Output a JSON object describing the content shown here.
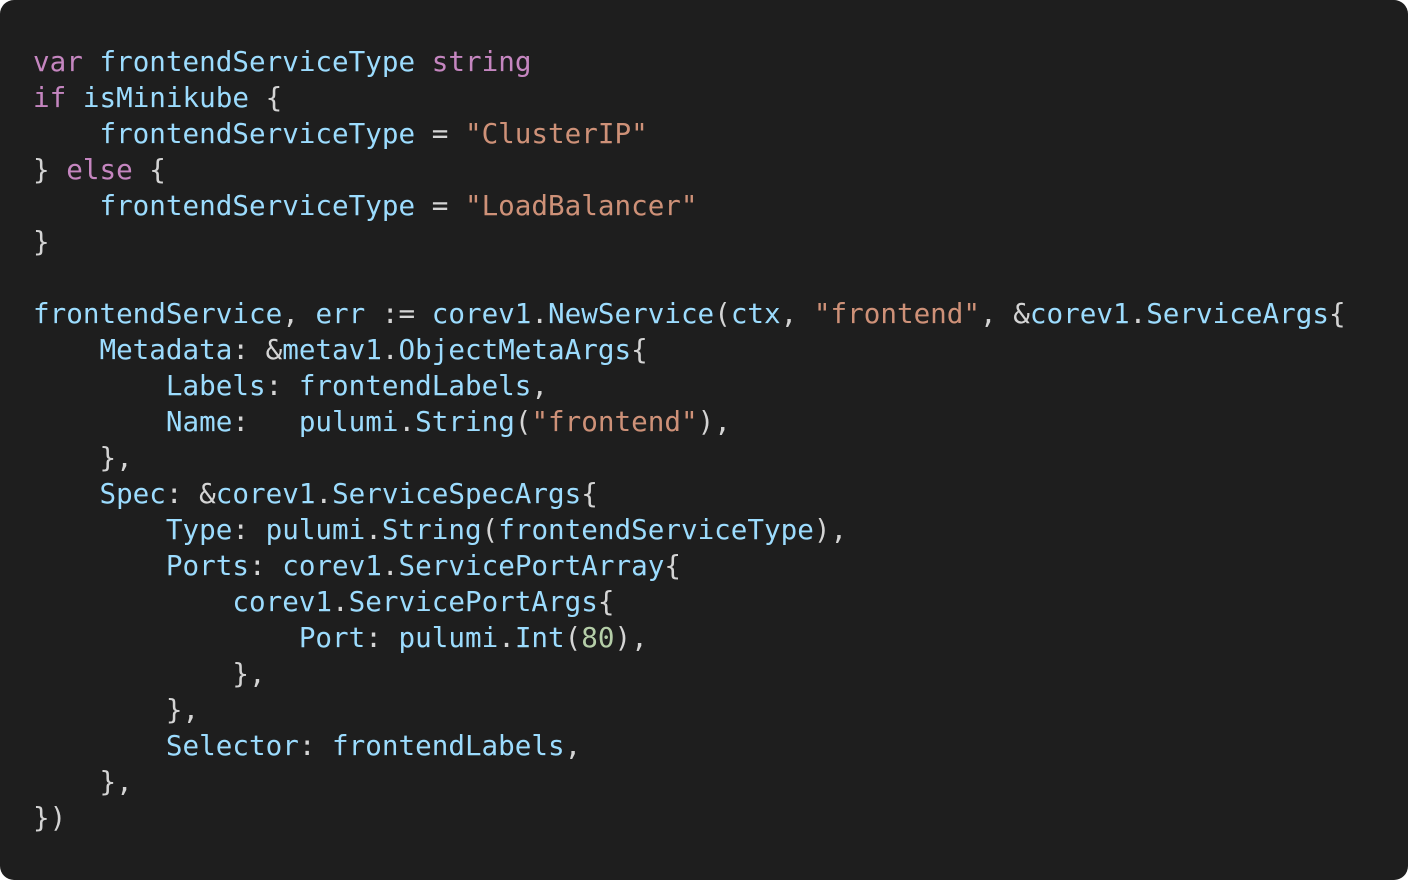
{
  "editor": {
    "background_color": "#1e1e1e",
    "token_colors": {
      "keyword": "#c586c0",
      "type": "#c586c0",
      "ident": "#9cdcfe",
      "func": "#9cdcfe",
      "string": "#ce9178",
      "number": "#b5cea8",
      "punct": "#d4d4d4",
      "plain": "#d4d4d4"
    },
    "lines": [
      [
        [
          "keyword",
          "var"
        ],
        [
          "plain",
          " "
        ],
        [
          "ident",
          "frontendServiceType"
        ],
        [
          "plain",
          " "
        ],
        [
          "type",
          "string"
        ]
      ],
      [
        [
          "keyword",
          "if"
        ],
        [
          "plain",
          " "
        ],
        [
          "ident",
          "isMinikube"
        ],
        [
          "plain",
          " {"
        ]
      ],
      [
        [
          "plain",
          "    "
        ],
        [
          "ident",
          "frontendServiceType"
        ],
        [
          "plain",
          " = "
        ],
        [
          "string",
          "\"ClusterIP\""
        ]
      ],
      [
        [
          "plain",
          "} "
        ],
        [
          "keyword",
          "else"
        ],
        [
          "plain",
          " {"
        ]
      ],
      [
        [
          "plain",
          "    "
        ],
        [
          "ident",
          "frontendServiceType"
        ],
        [
          "plain",
          " = "
        ],
        [
          "string",
          "\"LoadBalancer\""
        ]
      ],
      [
        [
          "plain",
          "}"
        ]
      ],
      [],
      [
        [
          "ident",
          "frontendService"
        ],
        [
          "plain",
          ", "
        ],
        [
          "ident",
          "err"
        ],
        [
          "plain",
          " := "
        ],
        [
          "ident",
          "corev1"
        ],
        [
          "plain",
          "."
        ],
        [
          "func",
          "NewService"
        ],
        [
          "plain",
          "("
        ],
        [
          "ident",
          "ctx"
        ],
        [
          "plain",
          ", "
        ],
        [
          "string",
          "\"frontend\""
        ],
        [
          "plain",
          ", &"
        ],
        [
          "ident",
          "corev1"
        ],
        [
          "plain",
          "."
        ],
        [
          "ident",
          "ServiceArgs"
        ],
        [
          "plain",
          "{"
        ]
      ],
      [
        [
          "plain",
          "    "
        ],
        [
          "ident",
          "Metadata"
        ],
        [
          "plain",
          ": &"
        ],
        [
          "ident",
          "metav1"
        ],
        [
          "plain",
          "."
        ],
        [
          "ident",
          "ObjectMetaArgs"
        ],
        [
          "plain",
          "{"
        ]
      ],
      [
        [
          "plain",
          "        "
        ],
        [
          "ident",
          "Labels"
        ],
        [
          "plain",
          ": "
        ],
        [
          "ident",
          "frontendLabels"
        ],
        [
          "plain",
          ","
        ]
      ],
      [
        [
          "plain",
          "        "
        ],
        [
          "ident",
          "Name"
        ],
        [
          "plain",
          ":   "
        ],
        [
          "ident",
          "pulumi"
        ],
        [
          "plain",
          "."
        ],
        [
          "func",
          "String"
        ],
        [
          "plain",
          "("
        ],
        [
          "string",
          "\"frontend\""
        ],
        [
          "plain",
          "),"
        ]
      ],
      [
        [
          "plain",
          "    },"
        ]
      ],
      [
        [
          "plain",
          "    "
        ],
        [
          "ident",
          "Spec"
        ],
        [
          "plain",
          ": &"
        ],
        [
          "ident",
          "corev1"
        ],
        [
          "plain",
          "."
        ],
        [
          "ident",
          "ServiceSpecArgs"
        ],
        [
          "plain",
          "{"
        ]
      ],
      [
        [
          "plain",
          "        "
        ],
        [
          "ident",
          "Type"
        ],
        [
          "plain",
          ": "
        ],
        [
          "ident",
          "pulumi"
        ],
        [
          "plain",
          "."
        ],
        [
          "func",
          "String"
        ],
        [
          "plain",
          "("
        ],
        [
          "ident",
          "frontendServiceType"
        ],
        [
          "plain",
          "),"
        ]
      ],
      [
        [
          "plain",
          "        "
        ],
        [
          "ident",
          "Ports"
        ],
        [
          "plain",
          ": "
        ],
        [
          "ident",
          "corev1"
        ],
        [
          "plain",
          "."
        ],
        [
          "ident",
          "ServicePortArray"
        ],
        [
          "plain",
          "{"
        ]
      ],
      [
        [
          "plain",
          "            "
        ],
        [
          "ident",
          "corev1"
        ],
        [
          "plain",
          "."
        ],
        [
          "ident",
          "ServicePortArgs"
        ],
        [
          "plain",
          "{"
        ]
      ],
      [
        [
          "plain",
          "                "
        ],
        [
          "ident",
          "Port"
        ],
        [
          "plain",
          ": "
        ],
        [
          "ident",
          "pulumi"
        ],
        [
          "plain",
          "."
        ],
        [
          "func",
          "Int"
        ],
        [
          "plain",
          "("
        ],
        [
          "number",
          "80"
        ],
        [
          "plain",
          "),"
        ]
      ],
      [
        [
          "plain",
          "            },"
        ]
      ],
      [
        [
          "plain",
          "        },"
        ]
      ],
      [
        [
          "plain",
          "        "
        ],
        [
          "ident",
          "Selector"
        ],
        [
          "plain",
          ": "
        ],
        [
          "ident",
          "frontendLabels"
        ],
        [
          "plain",
          ","
        ]
      ],
      [
        [
          "plain",
          "    },"
        ]
      ],
      [
        [
          "plain",
          "})"
        ]
      ]
    ]
  }
}
